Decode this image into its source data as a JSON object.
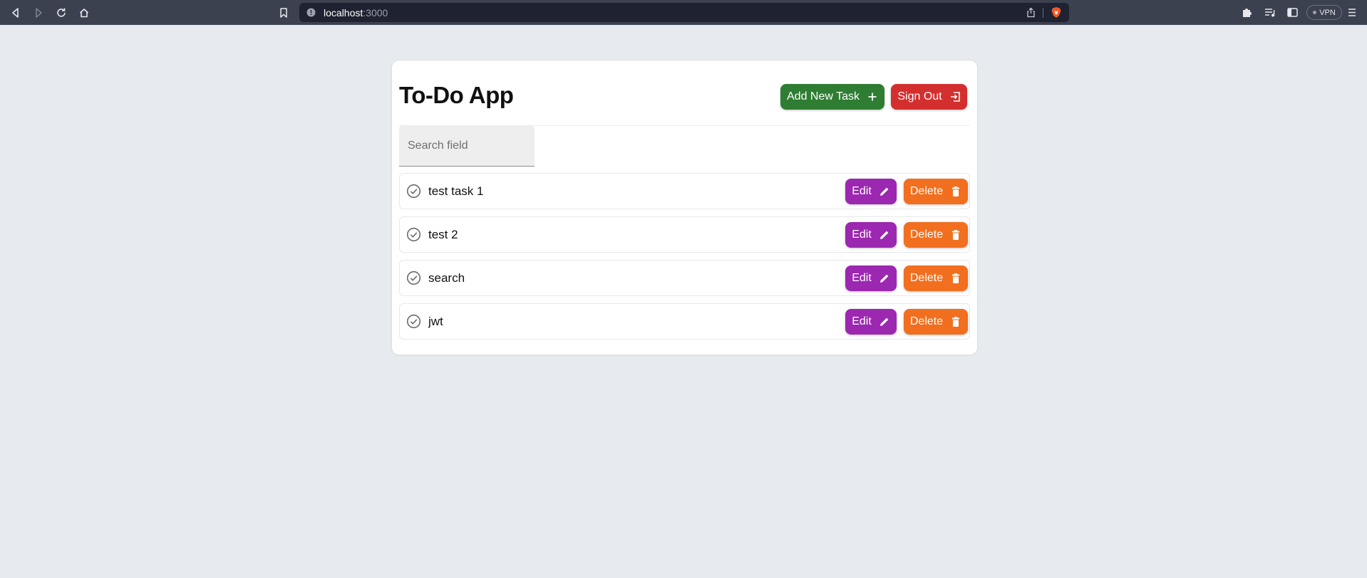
{
  "browser": {
    "url_host": "localhost",
    "url_port": ":3000",
    "vpn_label": "VPN"
  },
  "app": {
    "title": "To-Do App",
    "add_button_label": "Add New Task",
    "signout_button_label": "Sign Out",
    "search": {
      "placeholder": "Search field",
      "value": ""
    },
    "tasks": [
      {
        "text": "test task 1",
        "edit_label": "Edit",
        "delete_label": "Delete"
      },
      {
        "text": "test 2",
        "edit_label": "Edit",
        "delete_label": "Delete"
      },
      {
        "text": "search",
        "edit_label": "Edit",
        "delete_label": "Delete"
      },
      {
        "text": "jwt",
        "edit_label": "Edit",
        "delete_label": "Delete"
      }
    ]
  },
  "colors": {
    "add_button": "#2e7d32",
    "signout_button": "#d32f2f",
    "edit_button": "#9c27b0",
    "delete_button": "#f26f1f",
    "page_background": "#e7ebef",
    "browser_bar": "#3c4150"
  },
  "icons": {
    "add": "plus-icon",
    "signout": "logout-icon",
    "edit": "pencil-icon",
    "delete": "trash-icon",
    "task_status": "check-circle-icon"
  }
}
